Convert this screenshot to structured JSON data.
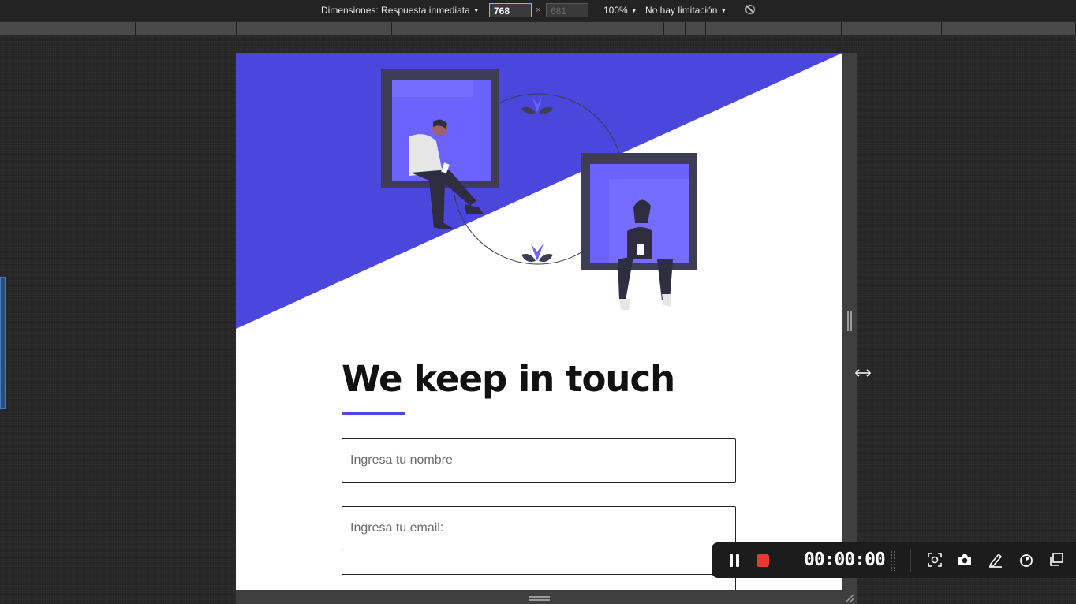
{
  "devtools": {
    "dimensions_label": "Dimensiones: Respuesta inmediata",
    "width_value": "768",
    "height_value": "681",
    "times": "×",
    "zoom": "100%",
    "throttle": "No hay limitación"
  },
  "page": {
    "title": "We keep in touch",
    "name_placeholder": "Ingresa tu nombre",
    "email_placeholder": "Ingresa tu email:",
    "accent_color": "#4b4be0"
  },
  "recorder": {
    "timer": "00:00:00",
    "record_color": "#e53935"
  },
  "icons": [
    "dropdown-caret-icon",
    "rotate-icon",
    "pause-icon",
    "stop-icon",
    "screenshot-region-icon",
    "camera-icon",
    "pen-icon",
    "timer-icon",
    "window-icon",
    "resize-corner-icon",
    "horizontal-resize-cursor-icon"
  ]
}
